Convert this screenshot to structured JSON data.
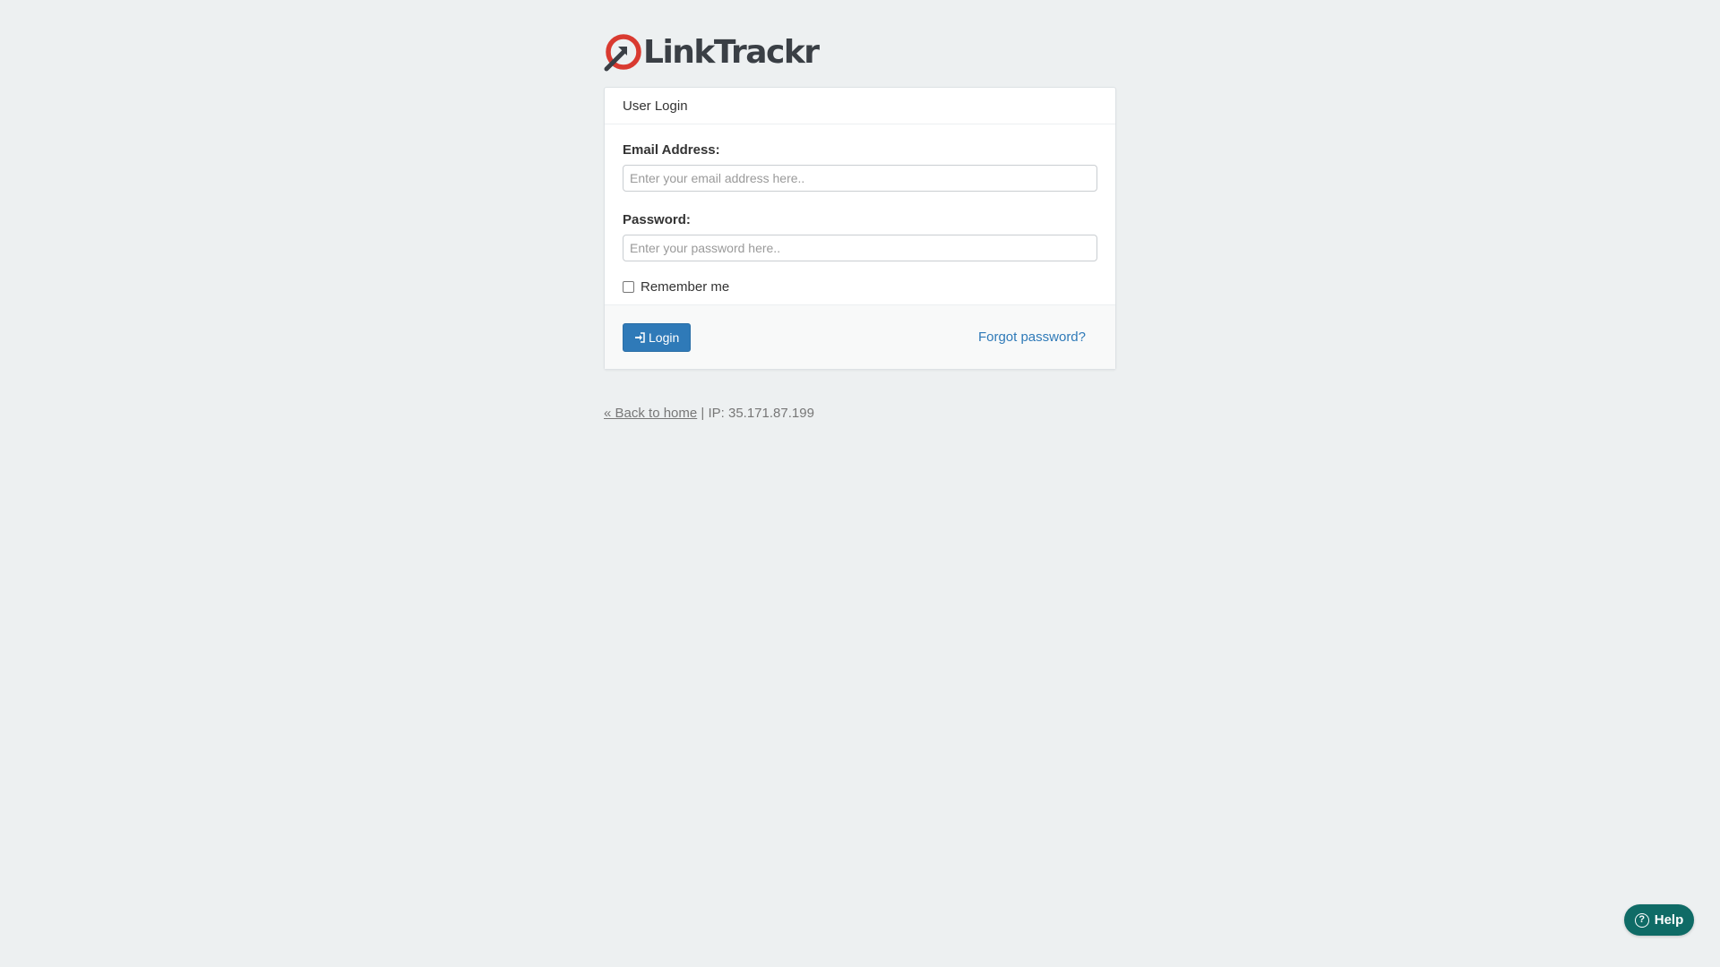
{
  "brand": {
    "name": "LinkTrackr",
    "logo_icon": "arrow-circle-logo-icon",
    "logo_color": "#d93a30"
  },
  "login_card": {
    "header": "User Login",
    "email": {
      "label": "Email Address:",
      "placeholder": "Enter your email address here..",
      "value": ""
    },
    "password": {
      "label": "Password:",
      "placeholder": "Enter your password here..",
      "value": ""
    },
    "remember": {
      "label": "Remember me",
      "checked": false
    },
    "login_button": {
      "label": "Login",
      "icon": "sign-in-icon",
      "color": "#2f7ab8"
    },
    "forgot_link": "Forgot password?"
  },
  "footer": {
    "back_link": "« Back to home",
    "separator": "|",
    "ip_text": "IP: 35.171.87.199"
  },
  "help_button": {
    "label": "Help",
    "icon": "question-circle-icon",
    "color": "#0f6b66"
  }
}
